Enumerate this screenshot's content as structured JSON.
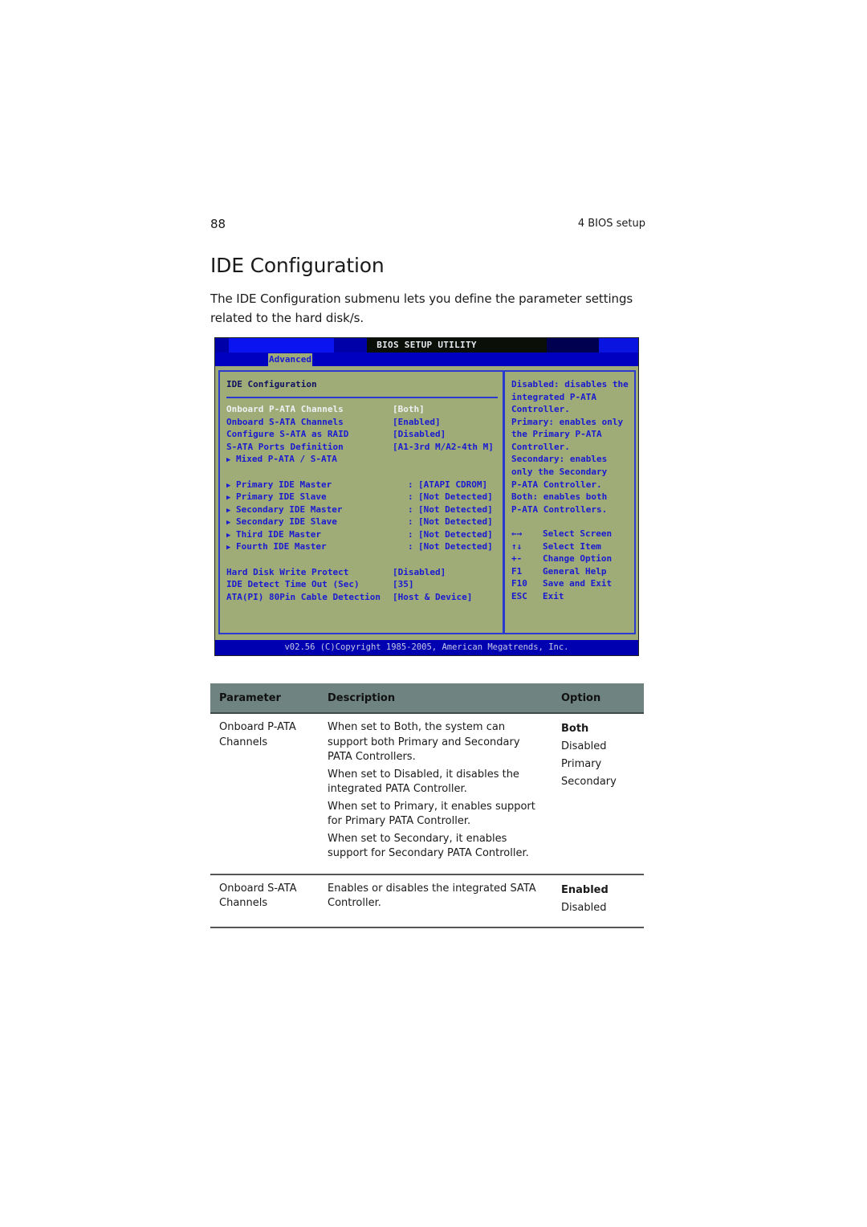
{
  "header": {
    "page_number": "88",
    "chapter": "4 BIOS setup"
  },
  "title": "IDE Configuration",
  "intro": "The IDE Configuration submenu lets you define the parameter settings related to the hard disk/s.",
  "bios": {
    "window_title": "BIOS SETUP UTILITY",
    "active_tab": "Advanced",
    "section_heading": "IDE Configuration",
    "items": [
      {
        "label": "Onboard P-ATA Channels",
        "value": "[Both]",
        "selected": true
      },
      {
        "label": "Onboard S-ATA Channels",
        "value": "[Enabled]"
      },
      {
        "label": "Configure S-ATA as RAID",
        "value": "[Disabled]"
      },
      {
        "label": "S-ATA Ports Definition",
        "value": "[A1-3rd M/A2-4th M]"
      },
      {
        "label": "Mixed P-ATA / S-ATA",
        "value": "",
        "submenu": true
      }
    ],
    "devices": [
      {
        "label": "Primary IDE Master",
        "value": "[ATAPI CDROM]"
      },
      {
        "label": "Primary IDE Slave",
        "value": "[Not Detected]"
      },
      {
        "label": "Secondary IDE Master",
        "value": "[Not Detected]"
      },
      {
        "label": "Secondary IDE Slave",
        "value": "[Not Detected]"
      },
      {
        "label": "Third IDE Master",
        "value": "[Not Detected]"
      },
      {
        "label": "Fourth IDE Master",
        "value": "[Not Detected]"
      }
    ],
    "other_items": [
      {
        "label": "Hard Disk Write Protect",
        "value": "[Disabled]"
      },
      {
        "label": "IDE Detect Time Out (Sec)",
        "value": "[35]"
      },
      {
        "label": "ATA(PI) 80Pin Cable Detection",
        "value": "[Host & Device]"
      }
    ],
    "help_text": [
      "Disabled: disables the",
      "integrated P-ATA",
      "Controller.",
      "Primary: enables only",
      "the Primary P-ATA",
      "Controller.",
      "Secondary: enables",
      "only the Secondary",
      "P-ATA Controller.",
      "Both: enables both",
      "P-ATA Controllers."
    ],
    "keys": [
      {
        "key": "←→",
        "action": "Select Screen"
      },
      {
        "key": "↑↓",
        "action": "Select Item"
      },
      {
        "key": "+-",
        "action": "Change Option"
      },
      {
        "key": "F1",
        "action": "General Help"
      },
      {
        "key": "F10",
        "action": "Save and Exit"
      },
      {
        "key": "ESC",
        "action": "Exit"
      }
    ],
    "footer": "v02.56 (C)Copyright 1985-2005, American Megatrends, Inc.",
    "submenu_arrow": "▶",
    "colon": ":"
  },
  "table": {
    "headers": [
      "Parameter",
      "Description",
      "Option"
    ],
    "rows": [
      {
        "parameter": "Onboard P-ATA Channels",
        "description": [
          "When set to Both, the system can support both Primary and Secondary PATA Controllers.",
          "When set to Disabled, it disables the integrated PATA Controller.",
          "When set to Primary, it enables support for Primary PATA Controller.",
          "When set to Secondary, it enables support for Secondary PATA  Controller."
        ],
        "options": [
          "Both",
          "Disabled",
          "Primary",
          "Secondary"
        ],
        "default": "Both"
      },
      {
        "parameter": "Onboard S-ATA Channels",
        "description": [
          "Enables or disables the integrated SATA Controller."
        ],
        "options": [
          "Enabled",
          "Disabled"
        ],
        "default": "Enabled"
      }
    ]
  },
  "colors": {
    "bios_background": "#9fac78",
    "bios_text": "#1a1ad0",
    "bios_bar": "#0000c0",
    "table_header": "#6f8481"
  }
}
